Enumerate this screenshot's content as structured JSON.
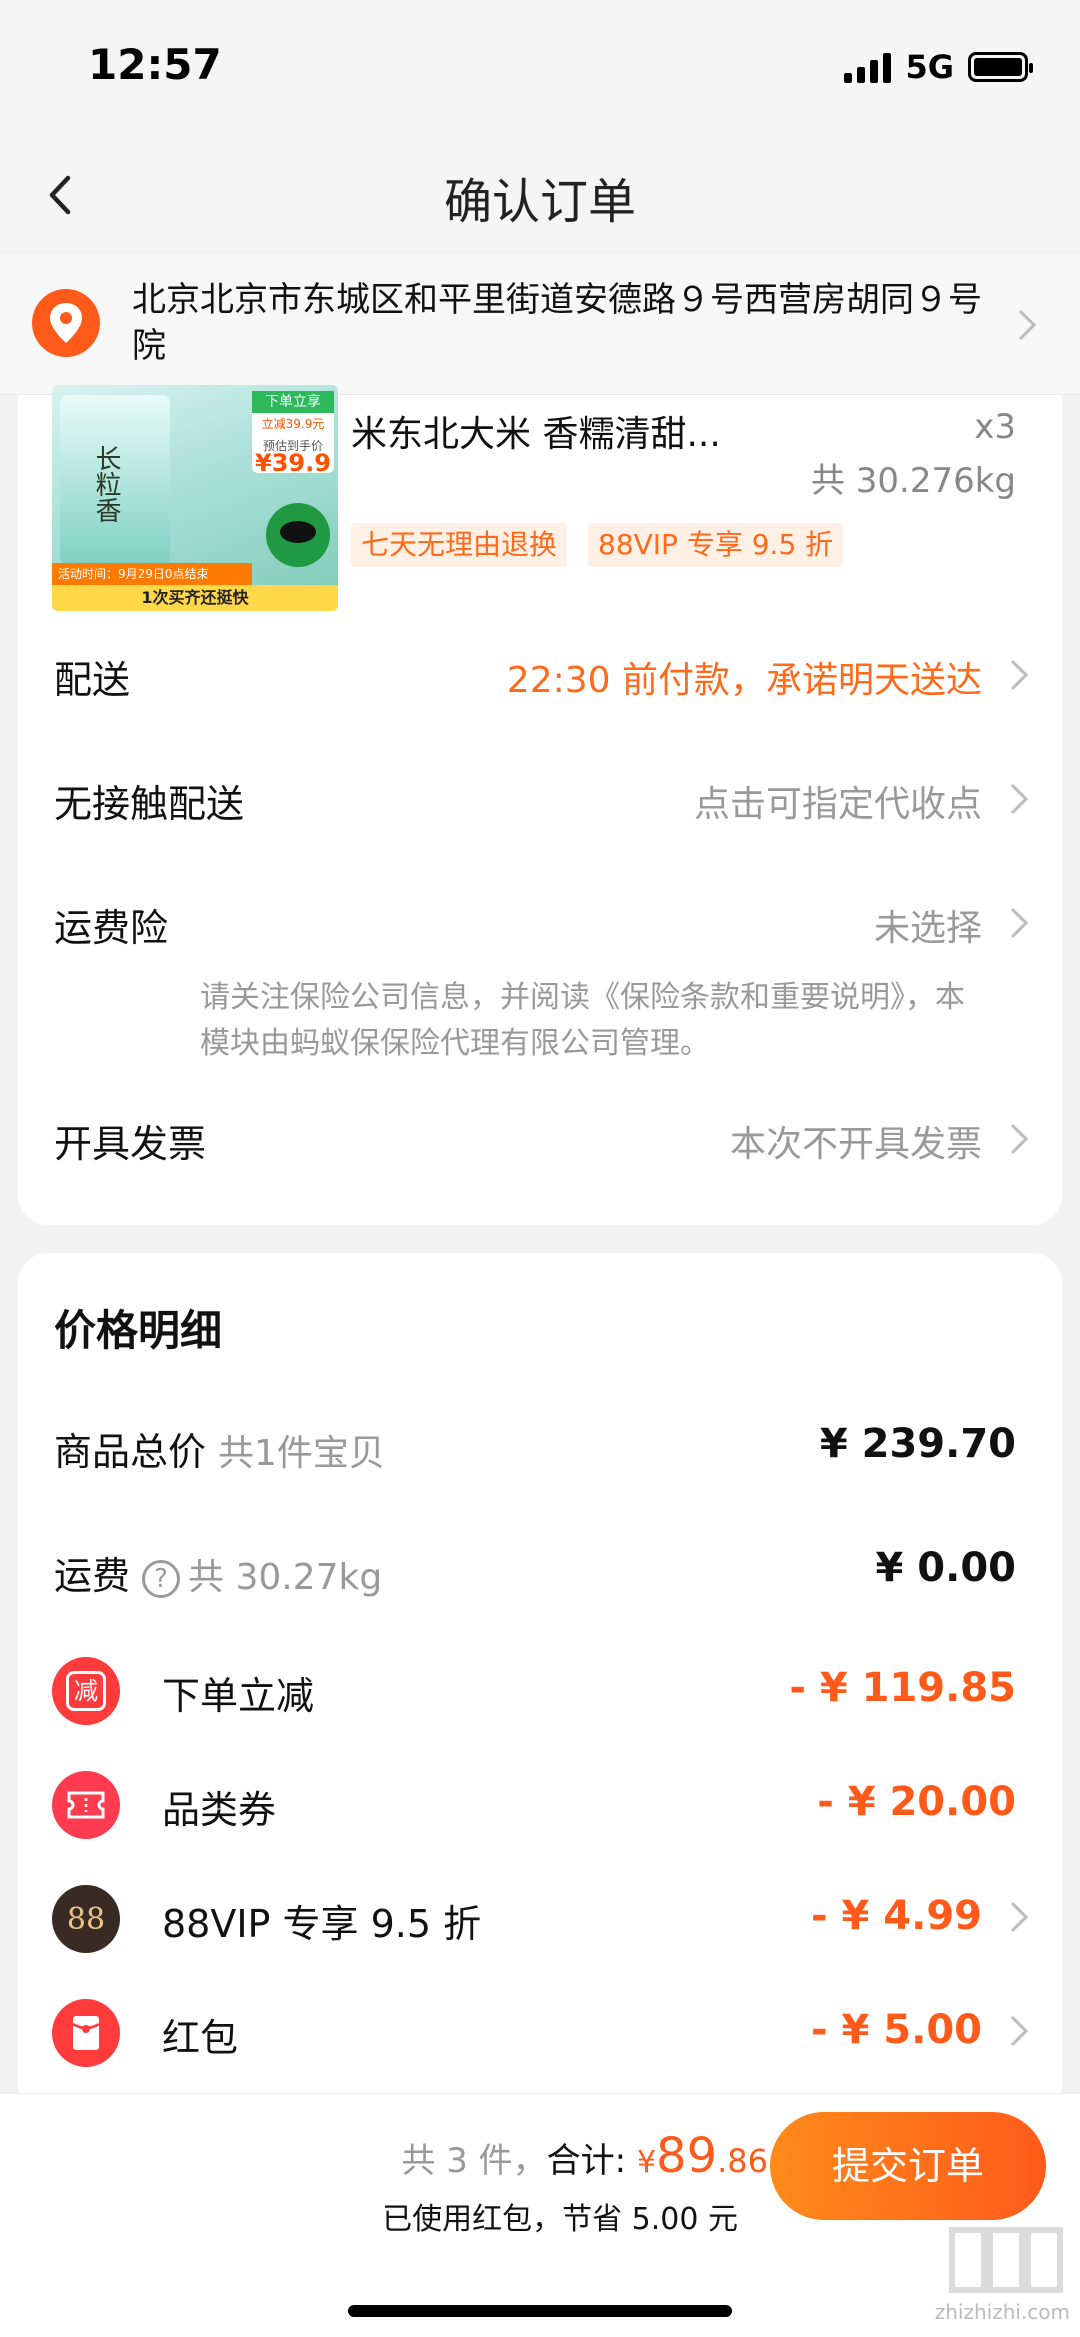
{
  "status_bar": {
    "time": "12:57",
    "network": "5G"
  },
  "nav": {
    "title": "确认订单"
  },
  "address": {
    "text": "北京北京市东城区和平里街道安德路９号西营房胡同９号院"
  },
  "product": {
    "title": "米东北大米 香糯清甜...",
    "qty": "x3",
    "weight": "共 30.276kg",
    "tags": [
      "七天无理由退换",
      "88VIP 专享 9.5 折"
    ],
    "image": {
      "promo_title": "下单立享",
      "promo_sub": "立减39.9元",
      "price_label": "预估到手价",
      "price": "¥39.9",
      "banner_time": "活动时间：9月29日0点结束",
      "banner": "1次买齐还挺快",
      "logo": "长粒香"
    }
  },
  "order_rows": {
    "delivery": {
      "label": "配送",
      "value": "22:30 前付款，承诺明天送达"
    },
    "contactless": {
      "label": "无接触配送",
      "value": "点击可指定代收点"
    },
    "insurance": {
      "label": "运费险",
      "value": "未选择",
      "note": "请关注保险公司信息，并阅读《保险条款和重要说明》，本模块由蚂蚁保保险代理有限公司管理。"
    },
    "invoice": {
      "label": "开具发票",
      "value": "本次不开具发票"
    }
  },
  "price_detail": {
    "title": "价格明细",
    "goods_total": {
      "label": "商品总价",
      "sub": "共1件宝贝",
      "value": "¥ 239.70"
    },
    "shipping": {
      "label": "运费",
      "sub": "共 30.27kg",
      "value": "¥ 0.00"
    },
    "discounts": [
      {
        "label": "下单立减",
        "value": "- ¥ 119.85",
        "icon": "reduce-icon",
        "icon_text": "减"
      },
      {
        "label": "品类券",
        "value": "- ¥ 20.00",
        "icon": "coupon-icon"
      },
      {
        "label": "88VIP 专享 9.5 折",
        "value": "- ¥ 4.99",
        "icon": "vip88-icon",
        "icon_text": "88"
      },
      {
        "label": "红包",
        "value": "- ¥ 5.00",
        "icon": "red-packet-icon"
      }
    ]
  },
  "bottom": {
    "count_text": "共 3 件，",
    "total_label": "合计:",
    "currency": "¥",
    "total_int": "89",
    "total_cents": ".86",
    "saved_text": "已使用红包，节省 5.00 元",
    "submit_label": "提交订单"
  },
  "watermark": {
    "text": "zhizhizhi.com"
  },
  "colors": {
    "accent": "#ff5a1a",
    "muted": "#999999",
    "background": "#f2f2f2"
  }
}
